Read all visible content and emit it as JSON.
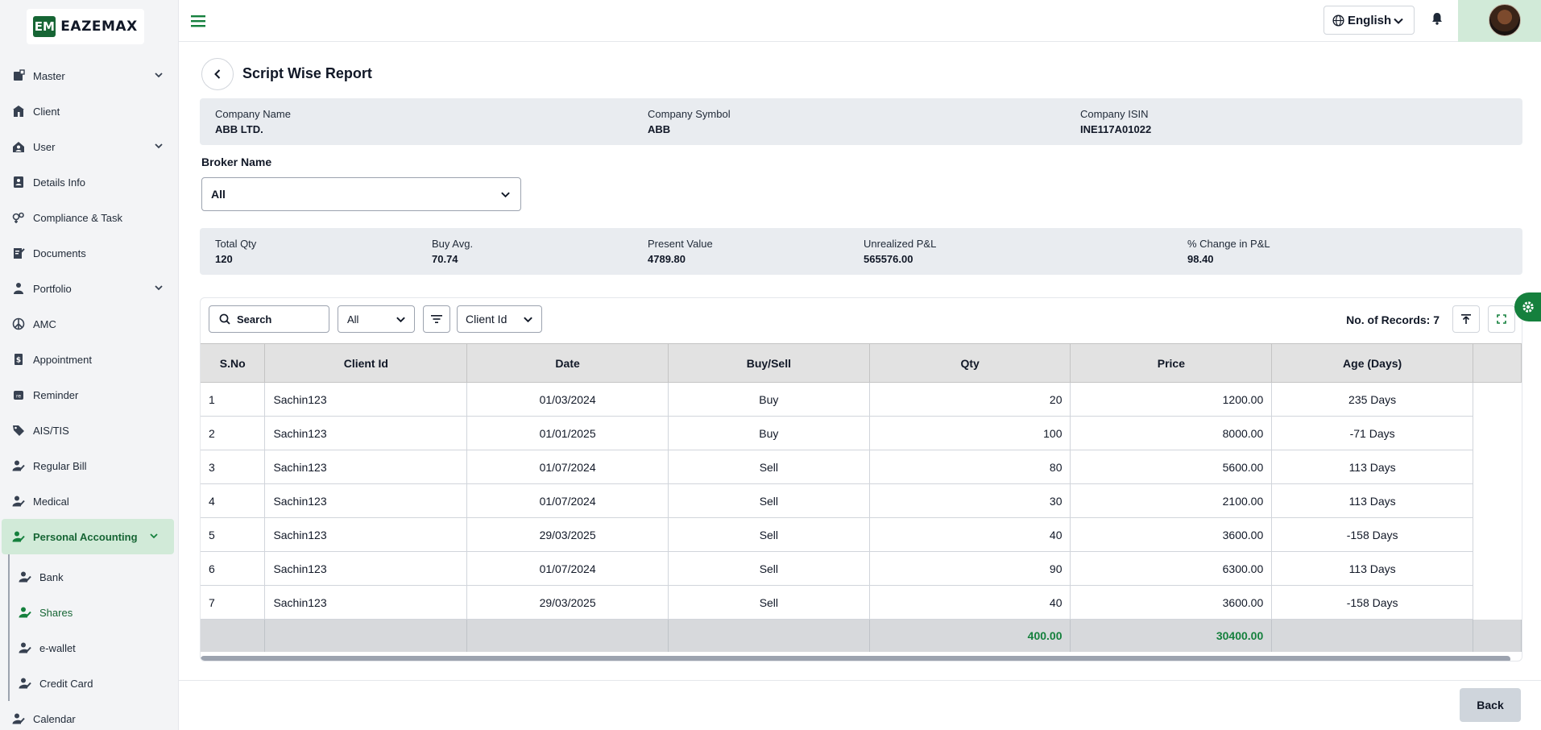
{
  "brand": {
    "mark": "EM",
    "name": "EAZEMAX"
  },
  "sidebar": {
    "items": [
      {
        "label": "Master",
        "icon": "master-icon",
        "has_chevron": true
      },
      {
        "label": "Client",
        "icon": "client-icon",
        "has_chevron": false
      },
      {
        "label": "User",
        "icon": "user-icon",
        "has_chevron": true
      },
      {
        "label": "Details Info",
        "icon": "details-info-icon",
        "has_chevron": false
      },
      {
        "label": "Compliance & Task",
        "icon": "compliance-icon",
        "has_chevron": false
      },
      {
        "label": "Documents",
        "icon": "documents-icon",
        "has_chevron": false
      },
      {
        "label": "Portfolio",
        "icon": "portfolio-icon",
        "has_chevron": true
      },
      {
        "label": "AMC",
        "icon": "amc-icon",
        "has_chevron": false
      },
      {
        "label": "Appointment",
        "icon": "appointment-icon",
        "has_chevron": false
      },
      {
        "label": "Reminder",
        "icon": "reminder-icon",
        "has_chevron": false
      },
      {
        "label": "AIS/TIS",
        "icon": "tag-icon",
        "has_chevron": false
      },
      {
        "label": "Regular Bill",
        "icon": "user-edit-icon",
        "has_chevron": false
      },
      {
        "label": "Medical",
        "icon": "user-edit-icon",
        "has_chevron": false
      },
      {
        "label": "Personal Accounting",
        "icon": "user-edit-icon",
        "has_chevron": true,
        "active": true
      }
    ],
    "subitems": [
      {
        "label": "Bank",
        "icon": "user-edit-icon"
      },
      {
        "label": "Shares",
        "icon": "user-edit-icon",
        "selected": true
      },
      {
        "label": "e-wallet",
        "icon": "user-edit-icon"
      },
      {
        "label": "Credit Card",
        "icon": "user-edit-icon"
      }
    ],
    "after": [
      {
        "label": "Calendar",
        "icon": "user-edit-icon"
      }
    ]
  },
  "header": {
    "language": "English"
  },
  "page": {
    "title": "Script Wise Report"
  },
  "company": {
    "name_label": "Company Name",
    "name_value": "ABB LTD.",
    "symbol_label": "Company Symbol",
    "symbol_value": "ABB",
    "isin_label": "Company ISIN",
    "isin_value": "INE117A01022"
  },
  "broker": {
    "label": "Broker Name",
    "value": "All"
  },
  "stats": {
    "total_qty_label": "Total Qty",
    "total_qty": "120",
    "buy_avg_label": "Buy Avg.",
    "buy_avg": "70.74",
    "present_value_label": "Present Value",
    "present_value": "4789.80",
    "unrealized_label": "Unrealized P&L",
    "unrealized": "565576.00",
    "pct_change_label": "% Change in P&L",
    "pct_change": "98.40"
  },
  "toolbar": {
    "search_placeholder": "Search",
    "type_filter": "All",
    "column_select": "Client Id",
    "records_label": "No. of Records: 7"
  },
  "table": {
    "headers": {
      "sno": "S.No",
      "client_id": "Client Id",
      "date": "Date",
      "buy_sell": "Buy/Sell",
      "qty": "Qty",
      "price": "Price",
      "age": "Age (Days)"
    },
    "rows": [
      {
        "sno": "1",
        "client_id": "Sachin123",
        "date": "01/03/2024",
        "buy_sell": "Buy",
        "qty": "20",
        "price": "1200.00",
        "age": "235 Days"
      },
      {
        "sno": "2",
        "client_id": "Sachin123",
        "date": "01/01/2025",
        "buy_sell": "Buy",
        "qty": "100",
        "price": "8000.00",
        "age": "-71 Days"
      },
      {
        "sno": "3",
        "client_id": "Sachin123",
        "date": "01/07/2024",
        "buy_sell": "Sell",
        "qty": "80",
        "price": "5600.00",
        "age": "113 Days"
      },
      {
        "sno": "4",
        "client_id": "Sachin123",
        "date": "01/07/2024",
        "buy_sell": "Sell",
        "qty": "30",
        "price": "2100.00",
        "age": "113 Days"
      },
      {
        "sno": "5",
        "client_id": "Sachin123",
        "date": "29/03/2025",
        "buy_sell": "Sell",
        "qty": "40",
        "price": "3600.00",
        "age": "-158 Days"
      },
      {
        "sno": "6",
        "client_id": "Sachin123",
        "date": "01/07/2024",
        "buy_sell": "Sell",
        "qty": "90",
        "price": "6300.00",
        "age": "113 Days"
      },
      {
        "sno": "7",
        "client_id": "Sachin123",
        "date": "29/03/2025",
        "buy_sell": "Sell",
        "qty": "40",
        "price": "3600.00",
        "age": "-158 Days"
      }
    ],
    "totals": {
      "qty": "400.00",
      "price": "30400.00"
    }
  },
  "footer": {
    "back_label": "Back"
  },
  "colors": {
    "accent": "#15803d",
    "active_bg": "#d1ead8",
    "panel_bg": "#e9ecf0"
  }
}
